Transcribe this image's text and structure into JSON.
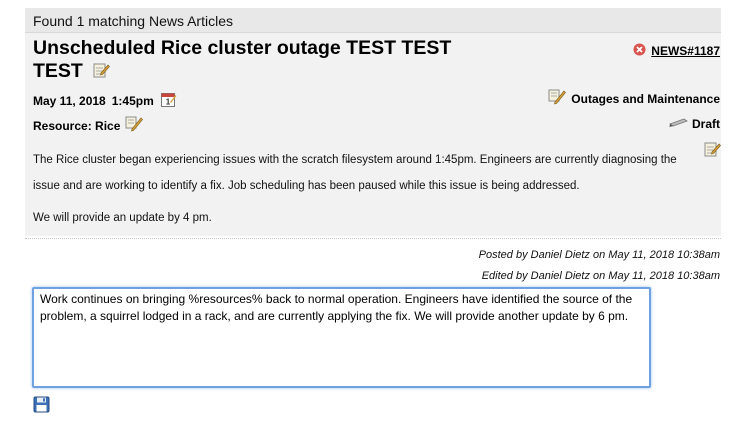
{
  "header": {
    "text": "Found 1 matching News Articles"
  },
  "article": {
    "title": "Unscheduled Rice cluster outage TEST TEST TEST",
    "news_id": "NEWS#1187",
    "date": "May 11, 2018",
    "time": "1:45pm",
    "category": "Outages and Maintenance",
    "resource": "Resource: Rice",
    "status": "Draft",
    "body": [
      "The Rice cluster began experiencing issues with the scratch filesystem around 1:45pm. Engineers are currently diagnosing the issue and are working to identify a fix. Job scheduling has been paused while this issue is being addressed.",
      "We will provide an update by 4 pm."
    ],
    "posted": "Posted by Daniel Dietz on May 11, 2018  10:38am",
    "edited": "Edited by Daniel Dietz on May 11, 2018  10:38am"
  },
  "editor": {
    "value": "Work continues on bringing %resources% back to normal operation. Engineers have identified the source of the problem, a squirrel lodged in a rack, and are currently applying the fix. We will provide another update by 6 pm."
  },
  "icons": {
    "edit": "edit-note-icon",
    "calendar": "calendar-icon",
    "delete": "delete-icon",
    "category": "pencil-note-icon",
    "status": "pencil-icon",
    "save": "save-disk-icon"
  },
  "colors": {
    "delete_red": "#d9534f",
    "editor_border": "#6fa0e0",
    "save_blue": "#3b6fb6"
  }
}
